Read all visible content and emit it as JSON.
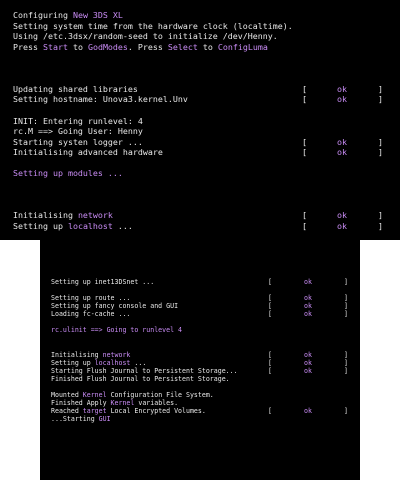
{
  "colors": {
    "background": "#000000",
    "text": "#e8e8e8",
    "highlight": "#c98cf5"
  },
  "top_screen": {
    "lines": [
      [
        {
          "t": "Configuring "
        },
        {
          "t": "New 3DS XL",
          "h": true
        }
      ],
      [
        {
          "t": "Setting system time from the hardware clock (localtime)."
        }
      ],
      [
        {
          "t": "Using /etc.3dsx/random-seed to initialize /dev/Henny."
        }
      ],
      [
        {
          "t": "Press "
        },
        {
          "t": "Start",
          "h": true
        },
        {
          "t": " to "
        },
        {
          "t": "GodModes",
          "h": true
        },
        {
          "t": ". Press "
        },
        {
          "t": "Select",
          "h": true
        },
        {
          "t": " to "
        },
        {
          "t": "ConfigLuma",
          "h": true
        }
      ],
      [],
      [],
      [],
      [
        {
          "t": "Updating shared libraries"
        }
      ],
      [
        {
          "t": "Setting hostname: Unova3.kernel.Unv"
        }
      ],
      [],
      [
        {
          "t": "INIT: Entering runlevel: 4"
        }
      ],
      [
        {
          "t": "rc.M ==> Going User: Henny"
        }
      ],
      [
        {
          "t": "Starting systen logger ..."
        }
      ],
      [
        {
          "t": "Initialising advanced hardware"
        }
      ],
      [],
      [
        {
          "t": "Setting up modules ...",
          "h": true
        }
      ],
      [],
      [],
      [],
      [
        {
          "t": "Initialising "
        },
        {
          "t": "network",
          "h": true
        }
      ],
      [
        {
          "t": "Setting up "
        },
        {
          "t": "localhost",
          "h": true
        },
        {
          "t": " ..."
        }
      ]
    ],
    "status_lines": [
      7,
      8,
      12,
      13,
      19,
      20
    ],
    "status": {
      "open": "[",
      "ok": "ok",
      "close": "]"
    }
  },
  "bottom_screen": {
    "lines": [
      [],
      [],
      [],
      [
        {
          "t": "Setting up inet13DSnet ..."
        }
      ],
      [],
      [
        {
          "t": "Setting up route ..."
        }
      ],
      [
        {
          "t": "Setting up fancy console and GUI"
        }
      ],
      [
        {
          "t": "Loading fc-cache ..."
        }
      ],
      [],
      [
        {
          "t": "rc.ulinit ==> Going to runlevel 4",
          "h": true
        }
      ],
      [],
      [],
      [
        {
          "t": "Initialising "
        },
        {
          "t": "network",
          "h": true
        }
      ],
      [
        {
          "t": "Setting up "
        },
        {
          "t": "localhost",
          "h": true
        },
        {
          "t": " ..."
        }
      ],
      [
        {
          "t": "Starting Flush Journal to Persistent Storage..."
        }
      ],
      [
        {
          "t": "Finished Flush Journal to Persistent Storage."
        }
      ],
      [],
      [
        {
          "t": "Mounted "
        },
        {
          "t": "Kernel",
          "h": true
        },
        {
          "t": " Configuration File System."
        }
      ],
      [
        {
          "t": "Finished Apply "
        },
        {
          "t": "Kernel",
          "h": true
        },
        {
          "t": " variables."
        }
      ],
      [
        {
          "t": "Reached "
        },
        {
          "t": "target",
          "h": true
        },
        {
          "t": " Local Encrypted Volumes."
        }
      ],
      [
        {
          "t": "...Starting "
        },
        {
          "t": "GUI",
          "h": true
        }
      ]
    ],
    "status_lines": [
      3,
      5,
      6,
      7,
      12,
      13,
      14,
      19
    ],
    "status": {
      "open": "[",
      "ok": "ok",
      "close": "]"
    }
  }
}
